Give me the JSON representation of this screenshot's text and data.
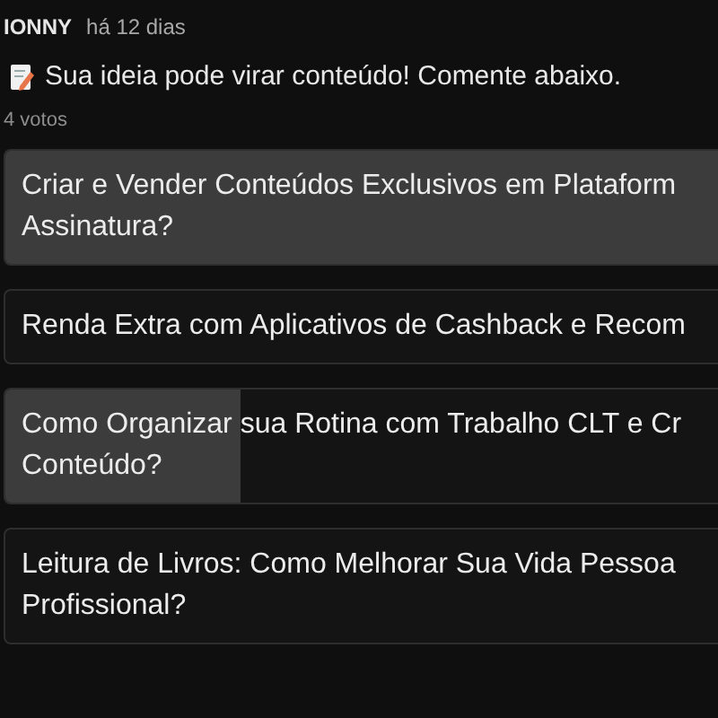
{
  "post": {
    "author": "IONNY",
    "time": "há 12 dias",
    "message": "Sua ideia pode virar conteúdo! Comente abaixo."
  },
  "poll": {
    "votes": "4 votos",
    "options": [
      {
        "lines": [
          "Criar e Vender Conteúdos Exclusivos em Plataform",
          "Assinatura?"
        ],
        "level": 1
      },
      {
        "lines": [
          "Renda Extra com Aplicativos de Cashback e Recom"
        ]
      },
      {
        "lines": [
          "Como Organizar sua Rotina com Trabalho CLT e Cr",
          "Conteúdo?"
        ],
        "level": 0.33
      },
      {
        "lines": [
          "Leitura de Livros: Como Melhorar Sua Vida Pessoa",
          "Profissional?"
        ]
      }
    ]
  }
}
